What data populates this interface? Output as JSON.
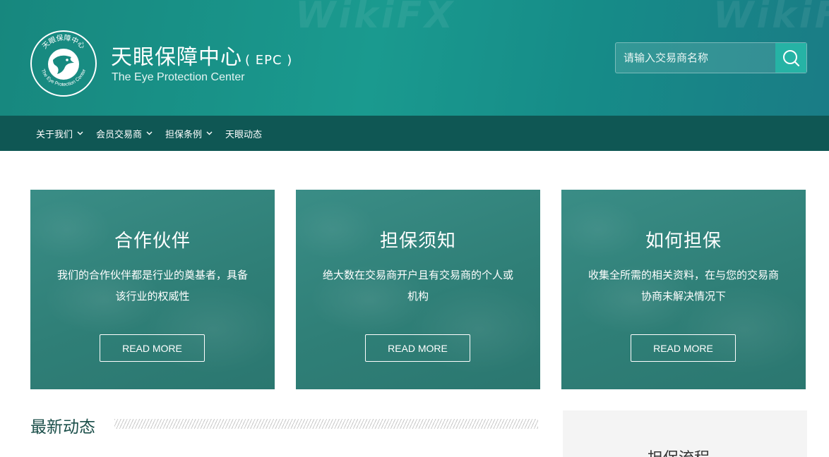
{
  "header": {
    "logo_ring_text": "天眼保障中心",
    "logo_ring_text_en": "The Eye Protection Center",
    "title": "天眼保障中心",
    "title_suffix": "( EPC )",
    "subtitle": "The Eye Protection Center",
    "search": {
      "placeholder": "请输入交易商名称",
      "value": ""
    },
    "watermark": "WikiFX"
  },
  "nav": {
    "items": [
      {
        "label": "关于我们",
        "has_dropdown": true
      },
      {
        "label": "会员交易商",
        "has_dropdown": true
      },
      {
        "label": "担保条例",
        "has_dropdown": true
      },
      {
        "label": "天眼动态",
        "has_dropdown": false
      }
    ]
  },
  "cards": [
    {
      "title": "合作伙伴",
      "desc": "我们的合作伙伴都是行业的奠基者，具备该行业的权威性",
      "button": "READ MORE"
    },
    {
      "title": "担保须知",
      "desc": "绝大数在交易商开户且有交易商的个人或机构",
      "button": "READ MORE"
    },
    {
      "title": "如何担保",
      "desc": "收集全所需的相关资料，在与您的交易商协商未解决情况下",
      "button": "READ MORE"
    }
  ],
  "news": {
    "title": "最新动态"
  },
  "side": {
    "title": "担保流程"
  },
  "colors": {
    "header_bg": "#1a9a8f",
    "nav_bg": "#0f5754",
    "card_bg": "#2f7f77",
    "accent": "#26b3a5",
    "news_title": "#1b4f4a"
  }
}
